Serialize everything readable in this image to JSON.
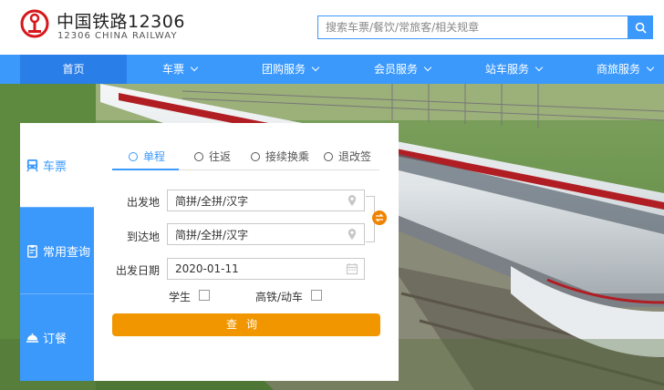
{
  "header": {
    "brand_title": "中国铁路12306",
    "brand_subtitle": "12306 CHINA RAILWAY",
    "search_placeholder": "搜索车票/餐饮/常旅客/相关规章"
  },
  "nav": {
    "items": [
      {
        "label": "首页",
        "active": true,
        "dropdown": false
      },
      {
        "label": "车票",
        "active": false,
        "dropdown": true
      },
      {
        "label": "团购服务",
        "active": false,
        "dropdown": true
      },
      {
        "label": "会员服务",
        "active": false,
        "dropdown": true
      },
      {
        "label": "站车服务",
        "active": false,
        "dropdown": true
      },
      {
        "label": "商旅服务",
        "active": false,
        "dropdown": true
      }
    ]
  },
  "sidebar": {
    "tabs": [
      {
        "label": "车票",
        "icon": "train-icon",
        "active": true
      },
      {
        "label": "常用查询",
        "icon": "clipboard-icon",
        "active": false
      },
      {
        "label": "订餐",
        "icon": "food-cloche-icon",
        "active": false
      }
    ]
  },
  "ticket_form": {
    "modes": [
      {
        "label": "单程",
        "active": true
      },
      {
        "label": "往返",
        "active": false
      },
      {
        "label": "接续换乘",
        "active": false
      },
      {
        "label": "退改签",
        "active": false
      }
    ],
    "from_label": "出发地",
    "from_value": "简拼/全拼/汉字",
    "to_label": "到达地",
    "to_value": "简拼/全拼/汉字",
    "date_label": "出发日期",
    "date_value": "2020-01-11",
    "student_label": "学生",
    "student_checked": false,
    "highspeed_label": "高铁/动车",
    "highspeed_checked": false,
    "query_button": "查询"
  },
  "colors": {
    "primary": "#3b99fc",
    "nav_active": "#2a7ee8",
    "accent_orange": "#f29600",
    "brand_red": "#d6171b"
  }
}
